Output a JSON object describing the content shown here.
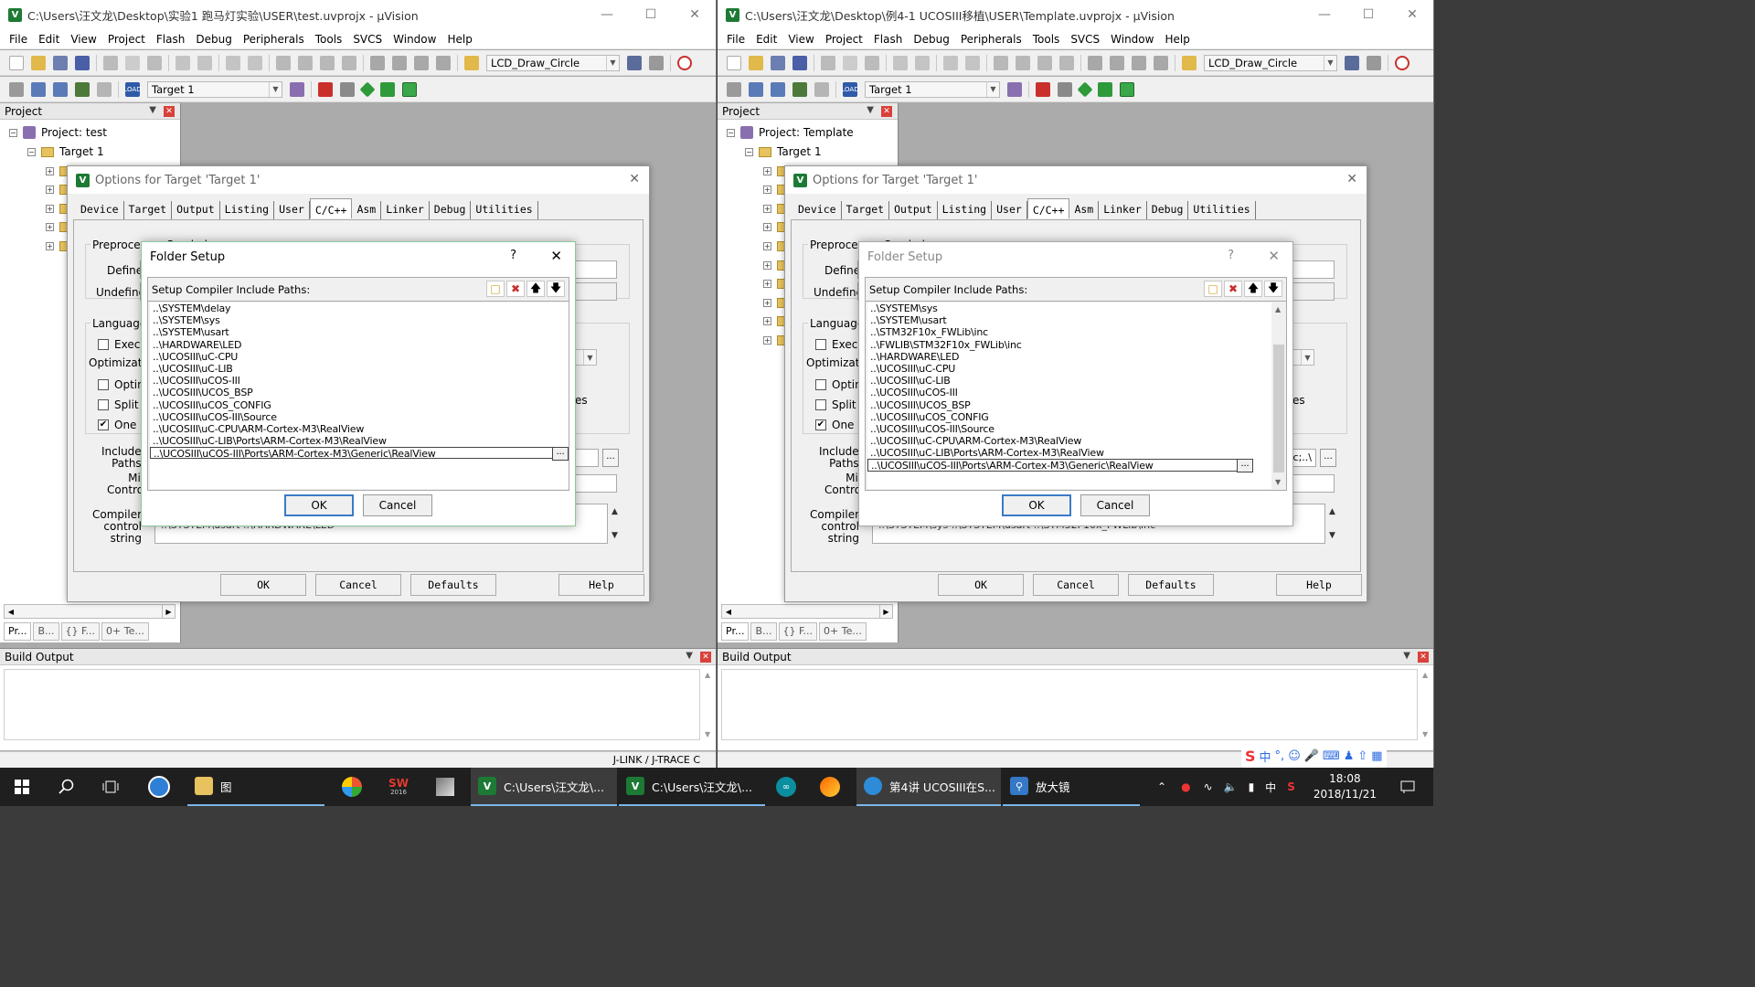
{
  "windows": [
    {
      "title": "C:\\Users\\汪文龙\\Desktop\\实验1 跑马灯实验\\USER\\test.uvprojx - µVision",
      "project_name": "Project: test",
      "define_label": "Define",
      "include_value": "",
      "compile_string": "..\\SYSTEM\\usart ..\\HARDWARE\\LED",
      "folder_setup_active": true,
      "folder_paths": [
        "..\\SYSTEM\\delay",
        "..\\SYSTEM\\sys",
        "..\\SYSTEM\\usart",
        "..\\HARDWARE\\LED",
        "..\\UCOSIII\\uC-CPU",
        "..\\UCOSIII\\uC-LIB",
        "..\\UCOSIII\\uCOS-III",
        "..\\UCOSIII\\UCOS_BSP",
        "..\\UCOSIII\\uCOS_CONFIG",
        "..\\UCOSIII\\uCOS-III\\Source",
        "..\\UCOSIII\\uC-CPU\\ARM-Cortex-M3\\RealView",
        "..\\UCOSIII\\uC-LIB\\Ports\\ARM-Cortex-M3\\RealView",
        "..\\UCOSIII\\uCOS-III\\Ports\\ARM-Cortex-M3\\Generic\\RealView"
      ],
      "tree_count": 5,
      "status": "J-LINK / J-TRACE C"
    },
    {
      "title": "C:\\Users\\汪文龙\\Desktop\\例4-1 UCOSIII移植\\USER\\Template.uvprojx - µVision",
      "project_name": "Project: Template",
      "define_label": "Define",
      "include_value": "nc;..\\",
      "compile_string": "..\\SYSTEM\\sys ..\\SYSTEM\\usart ..\\STM32F10x_FWLib\\inc",
      "folder_setup_active": false,
      "folder_paths": [
        "..\\SYSTEM\\sys",
        "..\\SYSTEM\\usart",
        "..\\STM32F10x_FWLib\\inc",
        "..\\FWLIB\\STM32F10x_FWLib\\inc",
        "..\\HARDWARE\\LED",
        "..\\UCOSIII\\uC-CPU",
        "..\\UCOSIII\\uC-LIB",
        "..\\UCOSIII\\uCOS-III",
        "..\\UCOSIII\\UCOS_BSP",
        "..\\UCOSIII\\uCOS_CONFIG",
        "..\\UCOSIII\\uCOS-III\\Source",
        "..\\UCOSIII\\uC-CPU\\ARM-Cortex-M3\\RealView",
        "..\\UCOSIII\\uC-LIB\\Ports\\ARM-Cortex-M3\\RealView",
        "..\\UCOSIII\\uCOS-III\\Ports\\ARM-Cortex-M3\\Generic\\RealView"
      ],
      "tree_count": 10,
      "status": ""
    }
  ],
  "menu": [
    "File",
    "Edit",
    "View",
    "Project",
    "Flash",
    "Debug",
    "Peripherals",
    "Tools",
    "SVCS",
    "Window",
    "Help"
  ],
  "toolbar": {
    "function_combo": "LCD_Draw_Circle",
    "target_combo": "Target 1"
  },
  "project_pane": {
    "header": "Project",
    "target": "Target 1",
    "tabs": [
      "Pr...",
      "B...",
      "{} F...",
      "0+ Te..."
    ]
  },
  "build_pane": {
    "header": "Build Output"
  },
  "options_dialog": {
    "title": "Options for Target 'Target 1'",
    "tabs": [
      "Device",
      "Target",
      "Output",
      "Listing",
      "User",
      "C/C++",
      "Asm",
      "Linker",
      "Debug",
      "Utilities"
    ],
    "active_tab": "C/C++",
    "preprocessor_label": "Preprocessor Symbols",
    "undefine_label": "Undefine",
    "language_label": "Language",
    "optimization_label": "Optimizatio",
    "checkbox_labels": [
      "Execu",
      "Optimi",
      "Split L",
      "One E"
    ],
    "checkbox_checked": [
      false,
      false,
      false,
      true
    ],
    "right_text": "es",
    "right_text2": "-I",
    "include_paths_label": "Include\nPaths",
    "misc_controls_label": "Misc\nControls",
    "compiler_control_label": "Compiler\ncontrol\nstring",
    "buttons": {
      "ok": "OK",
      "cancel": "Cancel",
      "defaults": "Defaults",
      "help": "Help"
    }
  },
  "folder_setup": {
    "title": "Folder Setup",
    "help": "?",
    "header": "Setup Compiler Include Paths:",
    "ok": "OK",
    "cancel": "Cancel",
    "edit_button": "..."
  },
  "taskbar": {
    "apps": [
      {
        "label": "图",
        "icon": "file-explorer-icon"
      },
      {
        "label": "C:\\Users\\汪文龙\\...",
        "icon": "uvision-icon"
      },
      {
        "label": "C:\\Users\\汪文龙\\...",
        "icon": "uvision-icon"
      },
      {
        "label": "第4讲 UCOSIII在S...",
        "icon": "video-app-icon"
      },
      {
        "label": "放大镜",
        "icon": "magnifier-icon"
      }
    ],
    "clock_time": "18:08",
    "clock_date": "2018/11/21",
    "ime": "中",
    "sw_badge": "SW",
    "sw_year": "2016"
  },
  "colors": {
    "uvision_green": "#1d7a35",
    "active_border": "#8fc79a",
    "taskbar": "#1f1f1f",
    "close_red": "#d9413a"
  }
}
